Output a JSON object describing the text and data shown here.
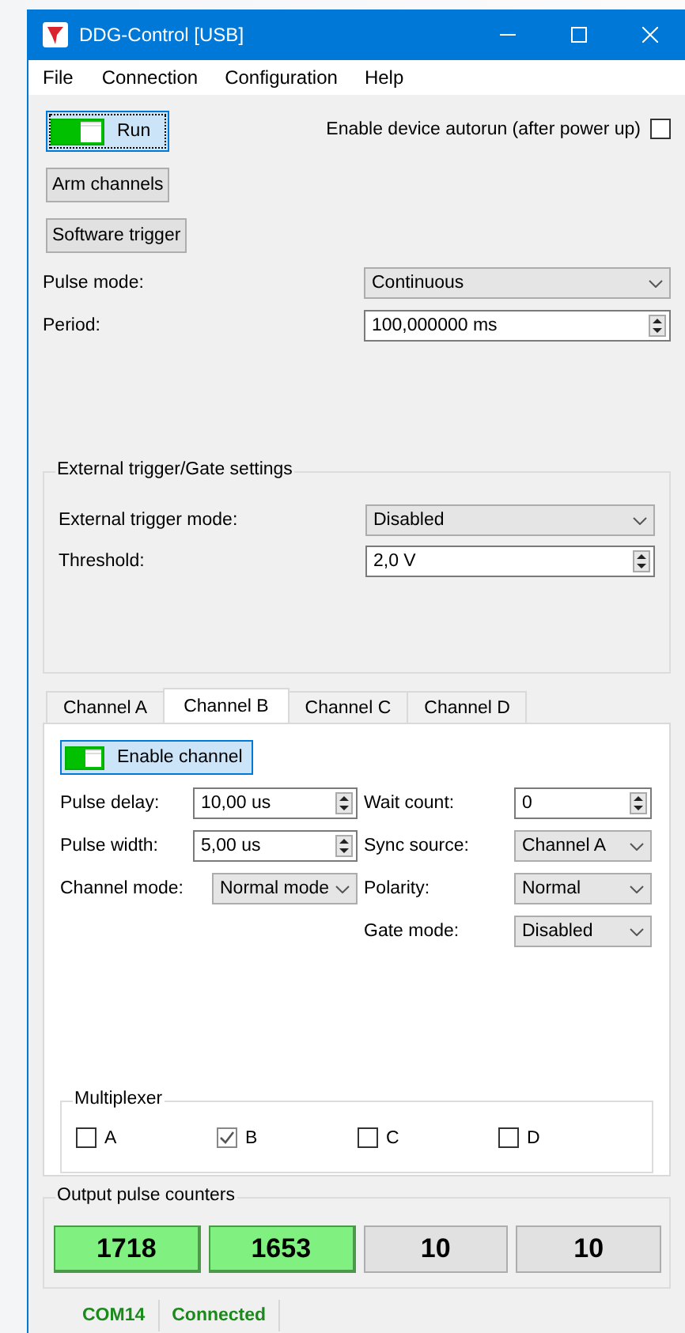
{
  "window": {
    "title": "DDG-Control [USB]"
  },
  "menu": [
    "File",
    "Connection",
    "Configuration",
    "Help"
  ],
  "run_toggle": {
    "label": "Run",
    "on": true
  },
  "autorun": {
    "label": "Enable device autorun (after power up)",
    "checked": false
  },
  "buttons": [
    "Arm channels",
    "Software trigger"
  ],
  "settings": [
    {
      "label": "Pulse mode:",
      "kind": "combo",
      "value": "Continuous"
    },
    {
      "label": "Period:",
      "kind": "spin",
      "value": "100,000000 ms"
    }
  ],
  "trigger_group": {
    "title": "External trigger/Gate settings",
    "fields": [
      {
        "label": "External trigger mode:",
        "kind": "combo",
        "value": "Disabled"
      },
      {
        "label": "Threshold:",
        "kind": "spin",
        "value": "2,0 V"
      }
    ]
  },
  "tabs": [
    {
      "label": "Channel A",
      "selected": false
    },
    {
      "label": "Channel B",
      "selected": true
    },
    {
      "label": "Channel C",
      "selected": false
    },
    {
      "label": "Channel D",
      "selected": false
    }
  ],
  "channel": {
    "enable_toggle": {
      "label": "Enable channel",
      "on": true
    },
    "rows": [
      {
        "left": {
          "label": "Pulse delay:",
          "kind": "spin",
          "value": "10,00 us"
        },
        "right": {
          "label": "Wait count:",
          "kind": "spin",
          "value": "0"
        }
      },
      {
        "left": {
          "label": "Pulse width:",
          "kind": "spin",
          "value": "5,00 us"
        },
        "right": {
          "label": "Sync source:",
          "kind": "combo",
          "value": "Channel A"
        }
      },
      {
        "left": {
          "label": "Channel mode:",
          "kind": "combo",
          "value": "Normal mode"
        },
        "right": {
          "label": "Polarity:",
          "kind": "combo",
          "value": "Normal"
        }
      },
      {
        "right": {
          "label": "Gate mode:",
          "kind": "combo",
          "value": "Disabled"
        }
      }
    ],
    "multiplexer": {
      "title": "Multiplexer",
      "options": [
        {
          "label": "A",
          "checked": false
        },
        {
          "label": "B",
          "checked": true
        },
        {
          "label": "C",
          "checked": false
        },
        {
          "label": "D",
          "checked": false
        }
      ]
    }
  },
  "counters": {
    "title": "Output pulse counters",
    "items": [
      {
        "value": "1718",
        "active": true
      },
      {
        "value": "1653",
        "active": true
      },
      {
        "value": "10",
        "active": false
      },
      {
        "value": "10",
        "active": false
      }
    ]
  },
  "status_bar": [
    "COM14",
    "Connected"
  ]
}
